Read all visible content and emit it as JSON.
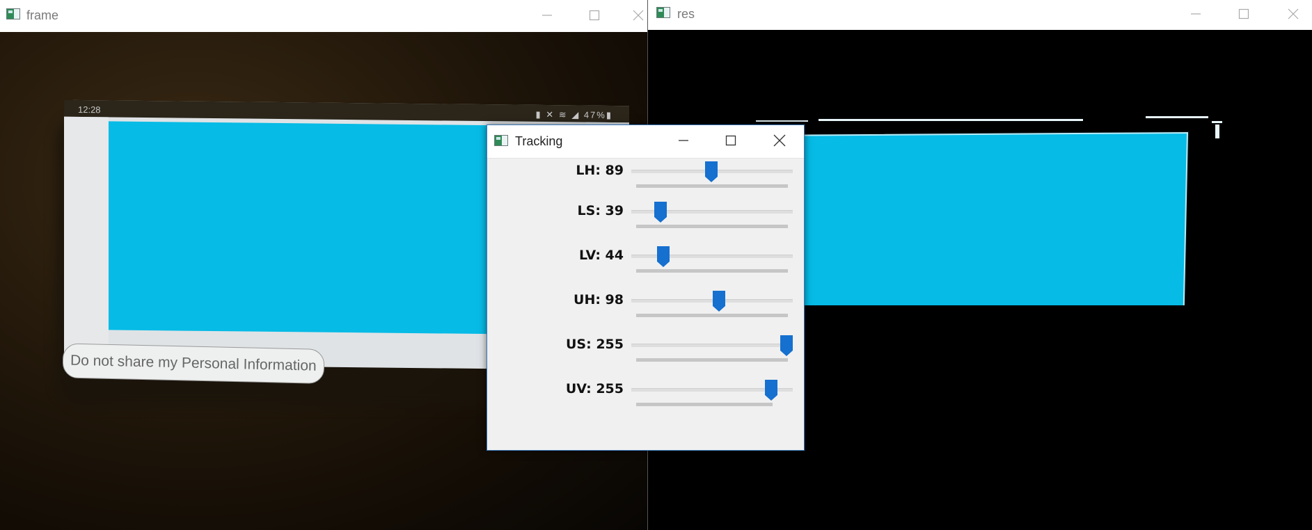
{
  "frame_window": {
    "title": "frame",
    "phone": {
      "time": "12:28",
      "status_icons": "▮ ✕ ≋ ◢ 47%▮",
      "banner_text": "Do not share my Personal Information",
      "screen_color": "#06bbe6"
    }
  },
  "res_window": {
    "title": "res",
    "mask_color": "#06bbe6"
  },
  "tracking_window": {
    "title": "Tracking",
    "trackbars": [
      {
        "label": "LH: 89",
        "value": 89,
        "max": 179
      },
      {
        "label": "LS: 39",
        "value": 39,
        "max": 255
      },
      {
        "label": "LV: 44",
        "value": 44,
        "max": 255
      },
      {
        "label": "UH: 98",
        "value": 98,
        "max": 179
      },
      {
        "label": "US: 255",
        "value": 255,
        "max": 255
      },
      {
        "label": "UV: 255",
        "value": 255,
        "max": 255
      }
    ],
    "thumb_color": "#1570d0"
  },
  "icons": {
    "minimize": "minimize-icon",
    "maximize": "maximize-icon",
    "close": "close-icon",
    "app": "opencv-window-icon"
  }
}
